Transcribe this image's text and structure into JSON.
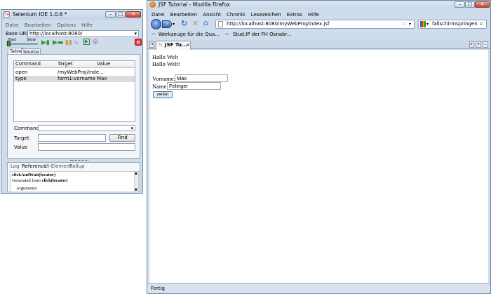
{
  "selenium": {
    "title": "Selenium IDE 1.0.6 *",
    "menu": [
      "Datei",
      "Bearbeiten",
      "Options",
      "Hilfe"
    ],
    "base_url_label": "Base URL",
    "base_url": "http://localhost:8080/",
    "fast": "Fast",
    "slow": "Slow",
    "tabs": [
      "Table",
      "Source"
    ],
    "columns": [
      "Command",
      "Target",
      "Value"
    ],
    "rows": [
      {
        "command": "open",
        "target": "/myWebProj/inde...",
        "value": ""
      },
      {
        "command": "type",
        "target": "form1:vorname",
        "value": "Max"
      }
    ],
    "command_label": "Command",
    "target_label": "Target",
    "value_label": "Value",
    "find": "Find",
    "bottom_tabs": [
      "Log",
      "Reference",
      "UI-Element",
      "Rollup"
    ],
    "ref_title": "clickAndWait(locator)",
    "ref_generated": "Generated from ",
    "ref_generated_bold": "click(locator)",
    "ref_args": "Arguments:"
  },
  "firefox": {
    "title": "JSF Tutorial - Mozilla Firefox",
    "menu": [
      "Datei",
      "Bearbeiten",
      "Ansicht",
      "Chronik",
      "Lesezeichen",
      "Extras",
      "Hilfe"
    ],
    "url": "http://localhost:8080/myWebProj/index.jsf",
    "search": "fallschirmspringen",
    "bookmarks": [
      "Werkzeuge für die Qua...",
      "Stud.IP der FH Osnabr..."
    ],
    "tab": "JSF Tu...",
    "status": "Fertig"
  },
  "page": {
    "line1": "Hallo Welt",
    "line2": "Hallo Welt!",
    "vorname_label": "Vorname:",
    "vorname": "Max",
    "name_label": "Name:",
    "name": "Felinger",
    "submit": "weiter"
  }
}
